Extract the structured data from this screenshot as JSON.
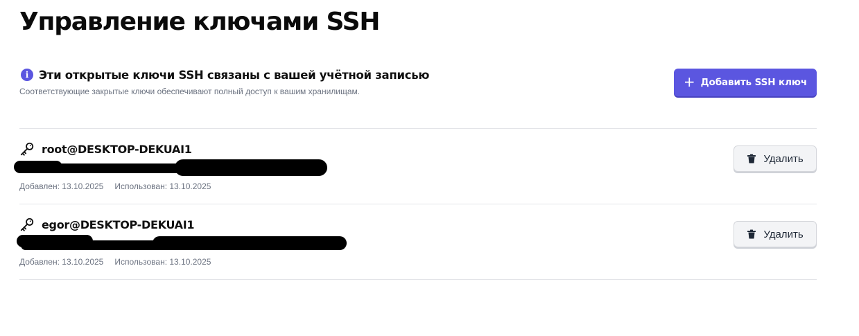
{
  "page": {
    "title": "Управление ключами SSH"
  },
  "info": {
    "icon": "info-icon",
    "icon_glyph": "i",
    "title": "Эти открытые ключи SSH связаны с вашей учётной записью",
    "subtitle": "Соответствующие закрытые ключи обеспечивают полный доступ к вашим хранилищам."
  },
  "actions": {
    "add_icon": "plus-icon",
    "add_glyph": "+",
    "add_label": "Добавить SSH ключ"
  },
  "keys": [
    {
      "icon": "key-icon",
      "name": "root@DESKTOP-DEKUAI1",
      "added": "Добавлен: 13.10.2025",
      "used": "Использован: 13.10.2025",
      "delete_icon": "trash-icon",
      "delete_label": "Удалить"
    },
    {
      "icon": "key-icon",
      "name": "egor@DESKTOP-DEKUAI1",
      "added": "Добавлен: 13.10.2025",
      "used": "Использован: 13.10.2025",
      "delete_icon": "trash-icon",
      "delete_label": "Удалить"
    }
  ],
  "colors": {
    "accent": "#5b56e0",
    "divider": "#e3e4e8",
    "muted_text": "#6b7280",
    "secondary_button_bg": "#f3f4f6"
  }
}
